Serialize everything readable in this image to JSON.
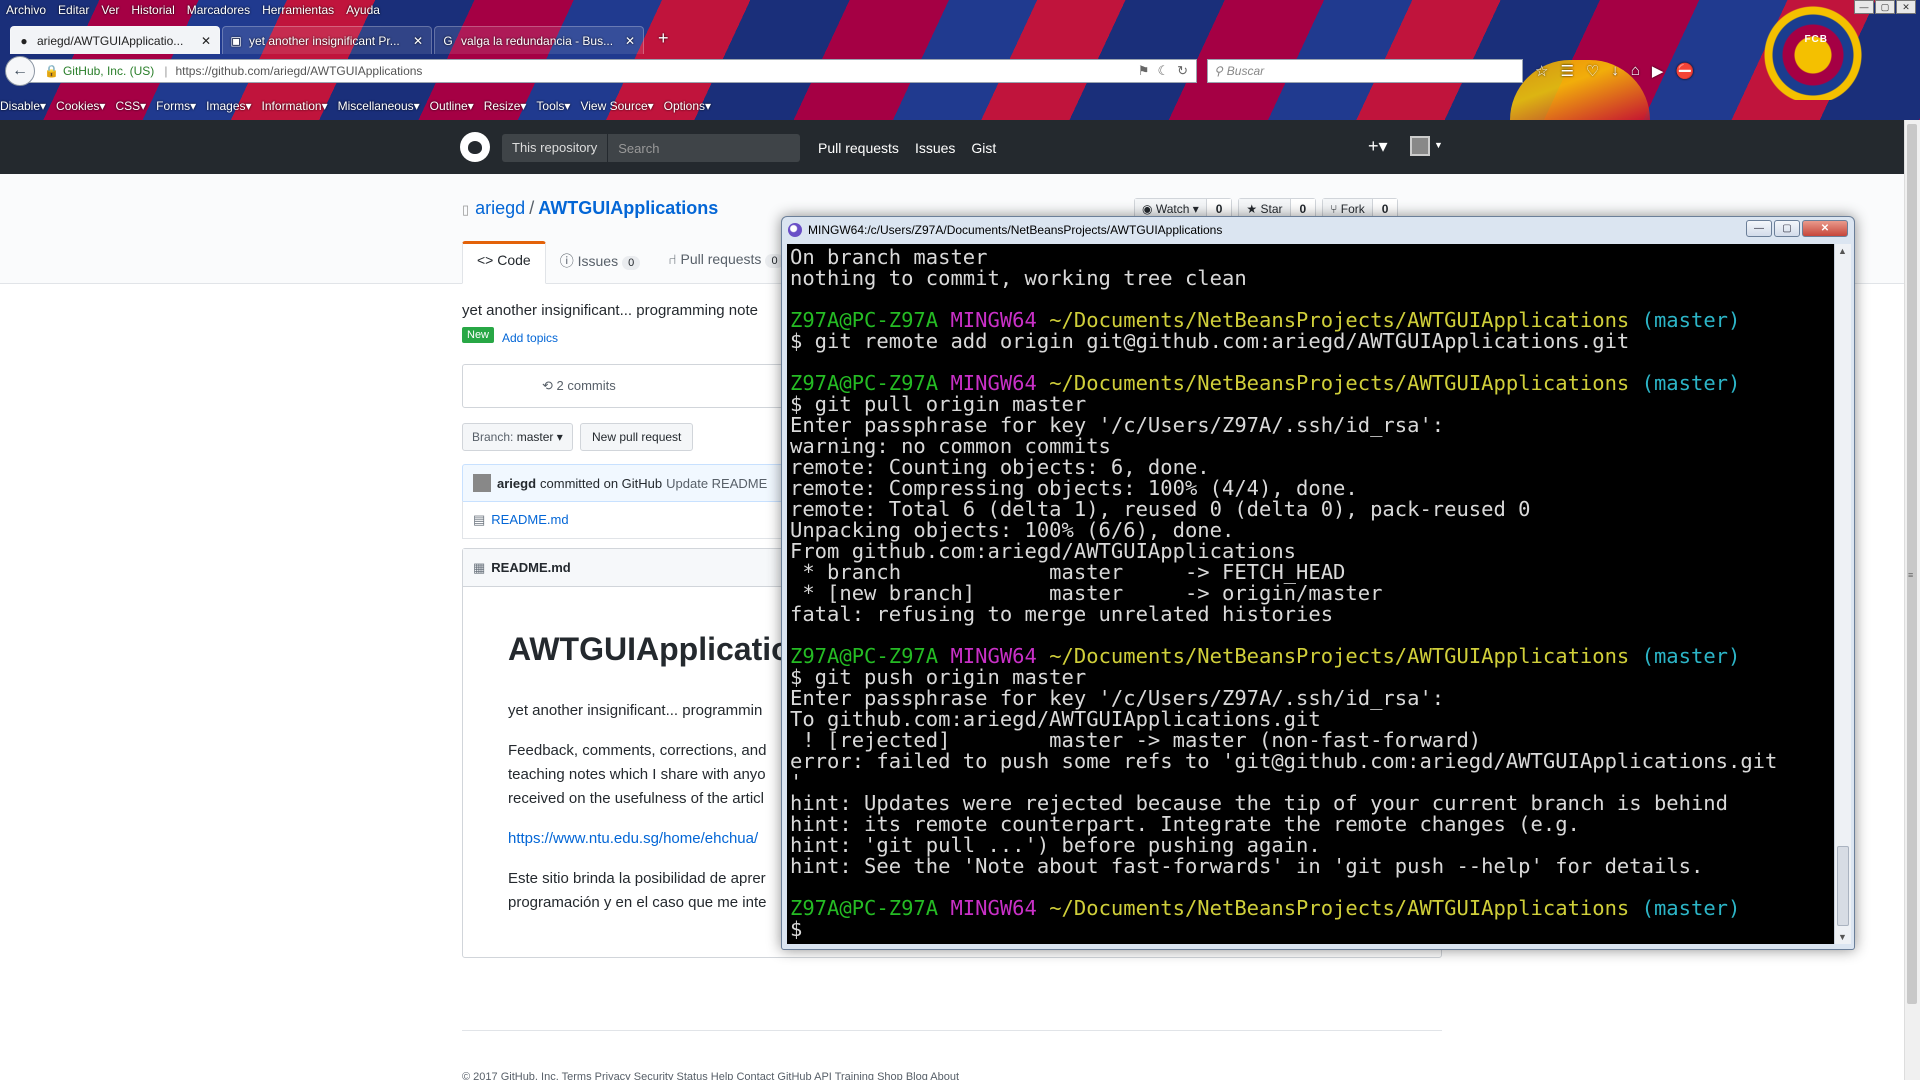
{
  "browser": {
    "menu": [
      "Archivo",
      "Editar",
      "Ver",
      "Historial",
      "Marcadores",
      "Herramientas",
      "Ayuda"
    ],
    "tabs": [
      {
        "icon": "github-icon",
        "title": "ariegd/AWTGUIApplicatio...",
        "close": "✕",
        "active": true
      },
      {
        "icon": "terminal-icon",
        "title": "yet another insignificant Pr...",
        "close": "✕",
        "active": false
      },
      {
        "icon": "google-icon",
        "title": "valga la redundancia - Bus...",
        "close": "✕",
        "active": false
      }
    ],
    "new_tab": "+",
    "url_identity": "GitHub, Inc. (US)",
    "url": "https://github.com/ariegd/AWTGUIApplications",
    "search_placeholder": "Buscar",
    "devbar": [
      "Disable▾",
      "Cookies▾",
      "CSS▾",
      "Forms▾",
      "Images▾",
      "Information▾",
      "Miscellaneous▾",
      "Outline▾",
      "Resize▾",
      "Tools▾",
      "View Source▾",
      "Options▾"
    ],
    "crest_text": "FCB"
  },
  "github": {
    "header": {
      "scope": "This repository",
      "search_placeholder": "Search",
      "nav": [
        "Pull requests",
        "Issues",
        "Gist"
      ],
      "plus": "+▾"
    },
    "repo": {
      "owner": "ariegd",
      "slash": "/",
      "name": "AWTGUIApplications",
      "watch_label": "Watch ▾",
      "watch_count": "0",
      "star_label": "★ Star",
      "star_count": "0",
      "fork_label": "Fork",
      "fork_count": "0",
      "tabs": {
        "code": "<> Code",
        "issues": "Issues",
        "issues_count": "0",
        "pulls": "Pull requests",
        "pulls_count": "0"
      },
      "description": "yet another insignificant... programming note",
      "new_badge": "New",
      "add_topics": "Add topics",
      "commits": "2 commits",
      "branch_label": "Branch:",
      "branch_name": "master ▾",
      "new_pr": "New pull request",
      "commit_author": "ariegd",
      "commit_via": "committed on GitHub",
      "commit_msg": "Update README",
      "file_name": "README.md",
      "readme_title": "README.md"
    },
    "readme": {
      "h1": "AWTGUIApplicatio",
      "p1": "yet another insignificant... programmin",
      "p2a": "Feedback, comments, corrections, and",
      "p2b": "teaching notes which I share with anyo",
      "p2c": "received on the usefulness of the articl",
      "link": "https://www.ntu.edu.sg/home/ehchua/",
      "p3a": "Este sitio brinda la posibilidad de aprer",
      "p3b": "programación y en el caso que me inte"
    },
    "footer": "© 2017 GitHub, Inc.   Terms   Privacy   Security   Status   Help                                                    Contact GitHub   API   Training   Shop   Blog   About"
  },
  "terminal": {
    "title": "MINGW64:/c/Users/Z97A/Documents/NetBeansProjects/AWTGUIApplications",
    "prompt_user": "Z97A@PC-Z97A",
    "prompt_env": "MINGW64",
    "prompt_path": "~/Documents/NetBeansProjects/AWTGUIApplications",
    "prompt_branch": "(master)",
    "lines": [
      {
        "t": "out",
        "text": "On branch master"
      },
      {
        "t": "out",
        "text": "nothing to commit, working tree clean"
      },
      {
        "t": "blank",
        "text": ""
      },
      {
        "t": "prompt",
        "text": ""
      },
      {
        "t": "out",
        "text": "$ git remote add origin git@github.com:ariegd/AWTGUIApplications.git"
      },
      {
        "t": "blank",
        "text": ""
      },
      {
        "t": "prompt",
        "text": ""
      },
      {
        "t": "out",
        "text": "$ git pull origin master"
      },
      {
        "t": "out",
        "text": "Enter passphrase for key '/c/Users/Z97A/.ssh/id_rsa':"
      },
      {
        "t": "out",
        "text": "warning: no common commits"
      },
      {
        "t": "out",
        "text": "remote: Counting objects: 6, done."
      },
      {
        "t": "out",
        "text": "remote: Compressing objects: 100% (4/4), done."
      },
      {
        "t": "out",
        "text": "remote: Total 6 (delta 1), reused 0 (delta 0), pack-reused 0"
      },
      {
        "t": "out",
        "text": "Unpacking objects: 100% (6/6), done."
      },
      {
        "t": "out",
        "text": "From github.com:ariegd/AWTGUIApplications"
      },
      {
        "t": "out",
        "text": " * branch            master     -> FETCH_HEAD"
      },
      {
        "t": "out",
        "text": " * [new branch]      master     -> origin/master"
      },
      {
        "t": "out",
        "text": "fatal: refusing to merge unrelated histories"
      },
      {
        "t": "blank",
        "text": ""
      },
      {
        "t": "prompt",
        "text": ""
      },
      {
        "t": "out",
        "text": "$ git push origin master"
      },
      {
        "t": "out",
        "text": "Enter passphrase for key '/c/Users/Z97A/.ssh/id_rsa':"
      },
      {
        "t": "out",
        "text": "To github.com:ariegd/AWTGUIApplications.git"
      },
      {
        "t": "out",
        "text": " ! [rejected]        master -> master (non-fast-forward)"
      },
      {
        "t": "out",
        "text": "error: failed to push some refs to 'git@github.com:ariegd/AWTGUIApplications.git"
      },
      {
        "t": "out",
        "text": "'"
      },
      {
        "t": "out",
        "text": "hint: Updates were rejected because the tip of your current branch is behind"
      },
      {
        "t": "out",
        "text": "hint: its remote counterpart. Integrate the remote changes (e.g."
      },
      {
        "t": "out",
        "text": "hint: 'git pull ...') before pushing again."
      },
      {
        "t": "out",
        "text": "hint: See the 'Note about fast-forwards' in 'git push --help' for details."
      },
      {
        "t": "blank",
        "text": ""
      },
      {
        "t": "prompt",
        "text": ""
      },
      {
        "t": "out",
        "text": "$"
      }
    ]
  }
}
